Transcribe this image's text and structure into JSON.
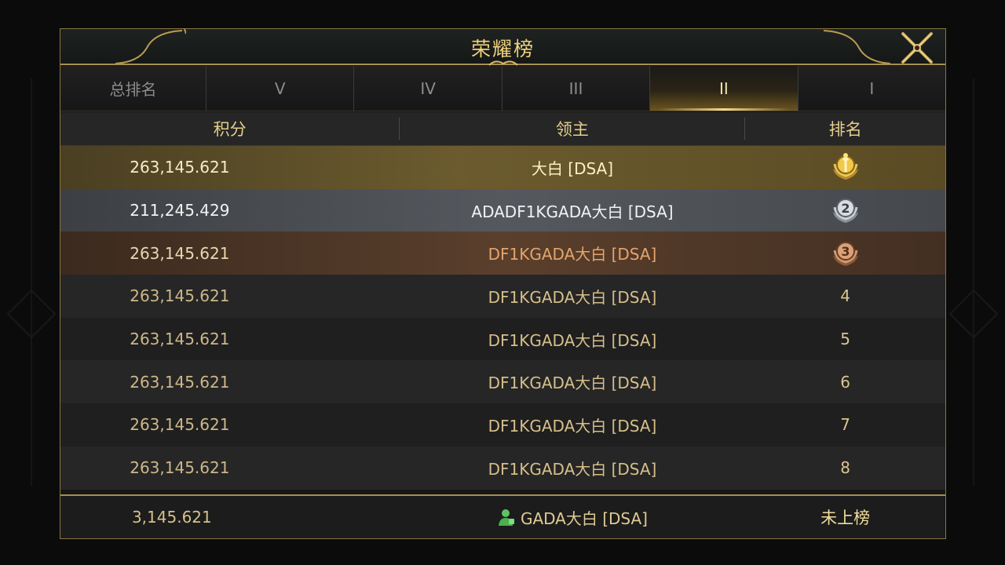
{
  "title": "荣耀榜",
  "tabs": [
    {
      "label": "总排名",
      "active": false
    },
    {
      "label": "V",
      "active": false
    },
    {
      "label": "IV",
      "active": false
    },
    {
      "label": "III",
      "active": false
    },
    {
      "label": "II",
      "active": true
    },
    {
      "label": "I",
      "active": false
    }
  ],
  "columns": {
    "score": "积分",
    "lord": "领主",
    "rank": "排名"
  },
  "rows": [
    {
      "score": "263,145.621",
      "lord": "大白 [DSA]",
      "rank": "1",
      "medal": "gold-medal-icon"
    },
    {
      "score": "211,245.429",
      "lord": "ADADF1KGADA大白 [DSA]",
      "rank": "2",
      "medal": "silver-medal-icon"
    },
    {
      "score": "263,145.621",
      "lord": "DF1KGADA大白 [DSA]",
      "rank": "3",
      "medal": "bronze-medal-icon"
    },
    {
      "score": "263,145.621",
      "lord": "DF1KGADA大白 [DSA]",
      "rank": "4"
    },
    {
      "score": "263,145.621",
      "lord": "DF1KGADA大白 [DSA]",
      "rank": "5"
    },
    {
      "score": "263,145.621",
      "lord": "DF1KGADA大白 [DSA]",
      "rank": "6"
    },
    {
      "score": "263,145.621",
      "lord": "DF1KGADA大白 [DSA]",
      "rank": "7"
    },
    {
      "score": "263,145.621",
      "lord": "DF1KGADA大白 [DSA]",
      "rank": "8"
    }
  ],
  "self_row": {
    "score": "3,145.621",
    "lord": "GADA大白 [DSA]",
    "rank": "未上榜",
    "avatar_icon": "player-avatar-icon"
  },
  "colors": {
    "gold": "#f0d27e",
    "accent_border": "#a88f4e",
    "self_avatar": "#4caf50"
  }
}
